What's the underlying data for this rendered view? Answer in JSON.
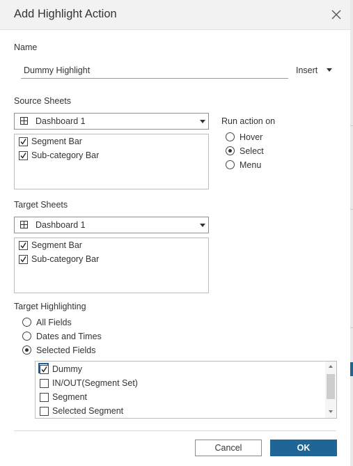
{
  "dialog": {
    "title": "Add Highlight Action",
    "close_icon": "close-icon"
  },
  "name_section": {
    "label": "Name",
    "value": "Dummy Highlight",
    "insert_label": "Insert"
  },
  "source": {
    "label": "Source Sheets",
    "dropdown_value": "Dashboard 1",
    "sheets": [
      {
        "label": "Segment Bar",
        "checked": true
      },
      {
        "label": "Sub-category Bar",
        "checked": true
      }
    ]
  },
  "run_action": {
    "label": "Run action on",
    "options": [
      {
        "label": "Hover",
        "selected": false
      },
      {
        "label": "Select",
        "selected": true
      },
      {
        "label": "Menu",
        "selected": false
      }
    ]
  },
  "target": {
    "label": "Target Sheets",
    "dropdown_value": "Dashboard 1",
    "sheets": [
      {
        "label": "Segment Bar",
        "checked": true
      },
      {
        "label": "Sub-category Bar",
        "checked": true
      }
    ]
  },
  "highlighting": {
    "label": "Target Highlighting",
    "options": [
      {
        "label": "All Fields",
        "selected": false
      },
      {
        "label": "Dates and Times",
        "selected": false
      },
      {
        "label": "Selected Fields",
        "selected": true
      }
    ],
    "fields": [
      {
        "label": "Dummy",
        "checked": true
      },
      {
        "label": "IN/OUT(Segment Set)",
        "checked": false
      },
      {
        "label": "Segment",
        "checked": false
      },
      {
        "label": "Selected Segment",
        "checked": false
      }
    ]
  },
  "buttons": {
    "cancel": "Cancel",
    "ok": "OK"
  },
  "colors": {
    "ok_button": "#1f6596",
    "focus": "#1a5fa8"
  }
}
